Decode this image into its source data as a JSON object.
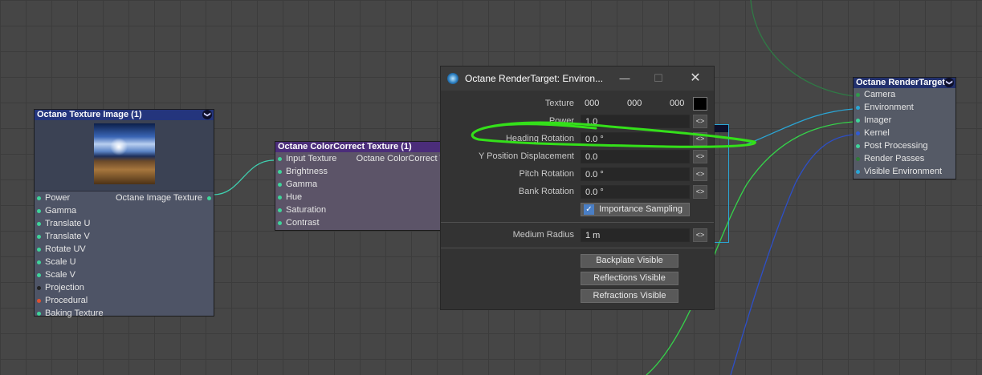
{
  "dialog": {
    "title": "Octane RenderTarget: Environ...",
    "controls": {
      "minimize": "—",
      "maximize": "☐",
      "close": "✕"
    },
    "texture": {
      "label": "Texture",
      "values": [
        "000",
        "000",
        "000"
      ]
    },
    "params": [
      {
        "label": "Power",
        "value": "1.0"
      },
      {
        "label": "Heading Rotation",
        "value": "0.0 °"
      },
      {
        "label": "Y Position Displacement",
        "value": "0.0"
      },
      {
        "label": "Pitch Rotation",
        "value": "0.0 °"
      },
      {
        "label": "Bank Rotation",
        "value": "0.0 °"
      }
    ],
    "importance_sampling": {
      "label": "Importance Sampling",
      "checked": true,
      "check": "✓"
    },
    "medium_radius": {
      "label": "Medium Radius",
      "value": "1 m"
    },
    "arrow_glyph": "<>",
    "buttons": [
      "Backplate Visible",
      "Reflections Visible",
      "Refractions Visible"
    ]
  },
  "nodes": {
    "texture_image": {
      "title": "Octane Texture Image (1)",
      "output": "Octane Image Texture",
      "inputs": [
        {
          "label": "Power",
          "color": "#3fd49a"
        },
        {
          "label": "Gamma",
          "color": "#3fd49a"
        },
        {
          "label": "Translate U",
          "color": "#3fd49a"
        },
        {
          "label": "Translate V",
          "color": "#3fd49a"
        },
        {
          "label": "Rotate UV",
          "color": "#3fd49a"
        },
        {
          "label": "Scale U",
          "color": "#3fd49a"
        },
        {
          "label": "Scale V",
          "color": "#3fd49a"
        },
        {
          "label": "Projection",
          "color": "#222222"
        },
        {
          "label": "Procedural",
          "color": "#e05030"
        },
        {
          "label": "Baking Texture",
          "color": "#3fd49a"
        }
      ]
    },
    "color_correct": {
      "title": "Octane ColorCorrect Texture (1)",
      "output": "Octane ColorCorrect Te",
      "inputs": [
        {
          "label": "Input Texture",
          "color": "#3fd49a"
        },
        {
          "label": "Brightness",
          "color": "#3fd49a"
        },
        {
          "label": "Gamma",
          "color": "#3fd49a"
        },
        {
          "label": "Hue",
          "color": "#3fd49a"
        },
        {
          "label": "Saturation",
          "color": "#3fd49a"
        },
        {
          "label": "Contrast",
          "color": "#3fd49a"
        }
      ]
    },
    "render_target": {
      "title": "Octane RenderTarget",
      "inputs": [
        {
          "label": "Camera",
          "color": "#2f9a4a"
        },
        {
          "label": "Environment",
          "color": "#2aa6d6"
        },
        {
          "label": "Imager",
          "color": "#3fd49a"
        },
        {
          "label": "Kernel",
          "color": "#2f5bd6"
        },
        {
          "label": "Post Processing",
          "color": "#3fd49a"
        },
        {
          "label": "Render Passes",
          "color": "#2f7a3a"
        },
        {
          "label": "Visible Environment",
          "color": "#2aa6d6"
        }
      ]
    },
    "chevron": "❯"
  },
  "colors": {
    "highlight_marker": "#34e01a",
    "wire_environment": "#2aa6d6",
    "wire_kernel": "#2d4fc8",
    "wire_imager": "#35d24a",
    "wire_camera": "#2f7a45"
  }
}
